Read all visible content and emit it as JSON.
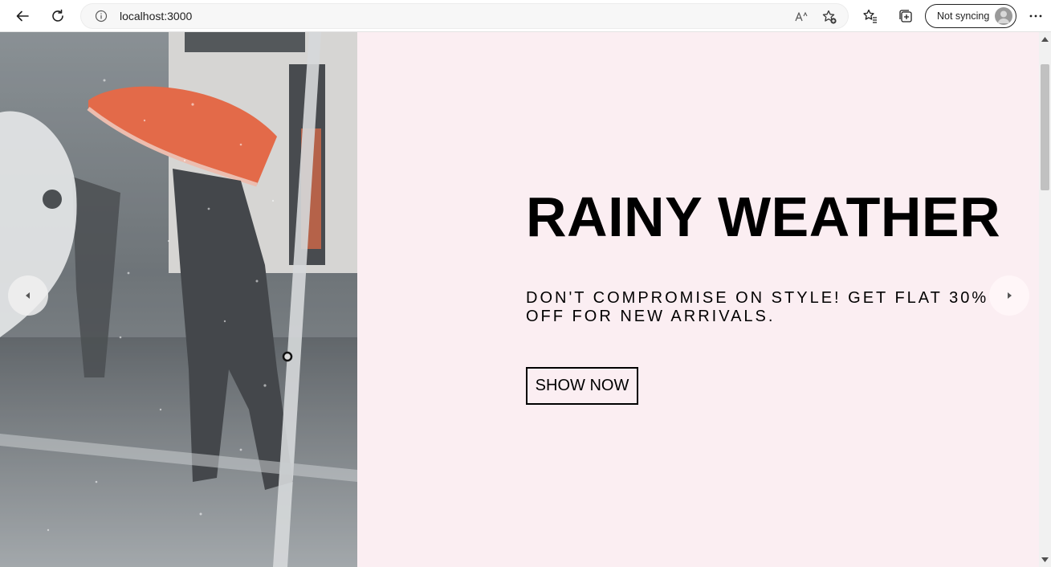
{
  "browser": {
    "url": "localhost:3000",
    "sync_label": "Not syncing"
  },
  "hero": {
    "title": "RAINY WEATHER",
    "description": "DON'T COMPROMISE ON STYLE! GET FLAT 30% OFF FOR NEW ARRIVALS.",
    "button_label": "SHOW NOW",
    "background_color": "#fbeef2",
    "image_alt": "Person with orange umbrella seen through rain-covered transparent plastic sheet"
  },
  "colors": {
    "accent_orange": "#e85a2c",
    "text": "#000000"
  }
}
